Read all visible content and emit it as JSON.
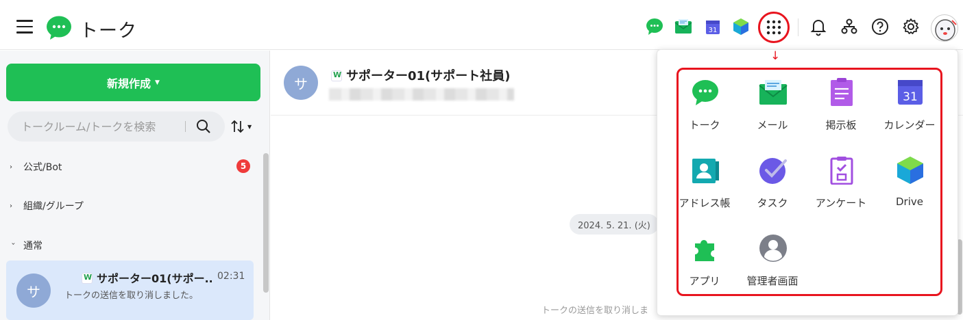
{
  "header": {
    "title": "トーク",
    "calendar_day": "31"
  },
  "sidebar": {
    "compose_label": "新規作成",
    "search_placeholder": "トークルーム/トークを検索",
    "sections": [
      {
        "label": "公式/Bot",
        "badge": "5",
        "expanded": false
      },
      {
        "label": "組織/グループ",
        "expanded": false
      },
      {
        "label": "通常",
        "expanded": true
      }
    ],
    "chat_item": {
      "avatar_initial": "サ",
      "name": "サポーター01(サポー...",
      "time": "02:31",
      "preview": "トークの送信を取り消しました。"
    }
  },
  "chat": {
    "avatar_initial": "サ",
    "title": "サポーター01(サポート社員)",
    "date_label": "2024. 5. 21. (火)",
    "deleted_note": "トークの送信を取り消しま"
  },
  "app_launcher": {
    "arrow": "↓",
    "apps": [
      {
        "label": "トーク",
        "icon": "talk-icon"
      },
      {
        "label": "メール",
        "icon": "mail-icon"
      },
      {
        "label": "掲示板",
        "icon": "board-icon"
      },
      {
        "label": "カレンダー",
        "icon": "calendar-icon",
        "day": "31"
      },
      {
        "label": "アドレス帳",
        "icon": "address-book-icon"
      },
      {
        "label": "タスク",
        "icon": "task-icon"
      },
      {
        "label": "アンケート",
        "icon": "survey-icon"
      },
      {
        "label": "Drive",
        "icon": "drive-icon"
      },
      {
        "label": "アプリ",
        "icon": "apps-puzzle-icon"
      },
      {
        "label": "管理者画面",
        "icon": "admin-icon"
      }
    ]
  },
  "colors": {
    "brand_green": "#1fbf55",
    "highlight_red": "#e8141e",
    "selected_row": "#dbe8fb",
    "badge_red": "#ef3b3b",
    "avatar_blue": "#8fa9d6"
  }
}
